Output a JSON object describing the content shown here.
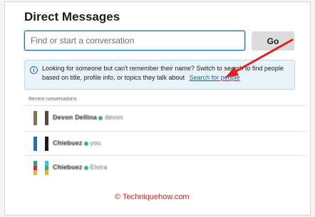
{
  "header": {
    "title": "Direct Messages"
  },
  "search": {
    "placeholder": "Find or start a conversation",
    "button_label": "Go"
  },
  "info_banner": {
    "text": "Looking for someone but can't remember their name? Switch to search to find people based on title, profile info, or topics they talk about",
    "link_label": "Search for people"
  },
  "recent": {
    "label": "Recent conversations",
    "items": [
      {
        "name": "Devon Dellina",
        "extra": "devon"
      },
      {
        "name": "Chiebuez",
        "extra": "you"
      },
      {
        "name": "Chiebuez",
        "extra": "Elvira"
      }
    ]
  },
  "watermark": "© Techniquehow.com",
  "annotation": {
    "arrow_color": "#e02020"
  }
}
